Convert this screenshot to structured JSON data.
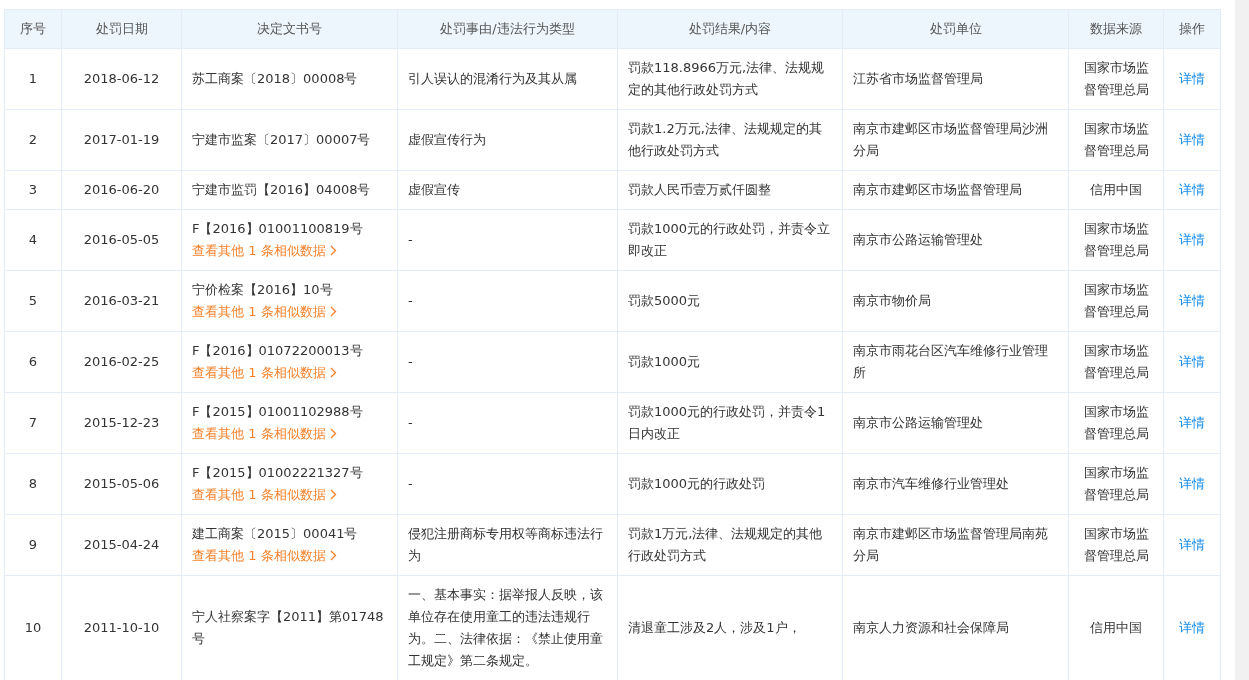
{
  "table": {
    "columns": [
      "序号",
      "处罚日期",
      "决定文书号",
      "处罚事由/违法行为类型",
      "处罚结果/内容",
      "处罚单位",
      "数据来源",
      "操作"
    ],
    "rows": [
      {
        "index": "1",
        "date": "2018-06-12",
        "doc_number": "苏工商案〔2018〕00008号",
        "reason": "引人误认的混淆行为及其从属",
        "result": "罚款118.8966万元,法律、法规规定的其他行政处罚方式",
        "authority": "江苏省市场监督管理局",
        "source": "国家市场监督管理总局",
        "action": "详情"
      },
      {
        "index": "2",
        "date": "2017-01-19",
        "doc_number": "宁建市监案〔2017〕00007号",
        "reason": "虚假宣传行为",
        "result": "罚款1.2万元,法律、法规规定的其他行政处罚方式",
        "authority": "南京市建邺区市场监督管理局沙洲分局",
        "source": "国家市场监督管理总局",
        "action": "详情"
      },
      {
        "index": "3",
        "date": "2016-06-20",
        "doc_number": "宁建市监罚【2016】04008号",
        "reason": "虚假宣传",
        "result": "罚款人民币壹万贰仟圆整",
        "authority": "南京市建邺区市场监督管理局",
        "source": "信用中国",
        "action": "详情"
      },
      {
        "index": "4",
        "date": "2016-05-05",
        "doc_number": "F【2016】01001100819号",
        "similar_link": "查看其他 1 条相似数据",
        "reason": "-",
        "result": "罚款1000元的行政处罚，并责令立即改正",
        "authority": "南京市公路运输管理处",
        "source": "国家市场监督管理总局",
        "action": "详情"
      },
      {
        "index": "5",
        "date": "2016-03-21",
        "doc_number": "宁价检案【2016】10号",
        "similar_link": "查看其他 1 条相似数据",
        "reason": "-",
        "result": "罚款5000元",
        "authority": "南京市物价局",
        "source": "国家市场监督管理总局",
        "action": "详情"
      },
      {
        "index": "6",
        "date": "2016-02-25",
        "doc_number": "F【2016】01072200013号",
        "similar_link": "查看其他 1 条相似数据",
        "reason": "-",
        "result": "罚款1000元",
        "authority": "南京市雨花台区汽车维修行业管理所",
        "source": "国家市场监督管理总局",
        "action": "详情"
      },
      {
        "index": "7",
        "date": "2015-12-23",
        "doc_number": "F【2015】01001102988号",
        "similar_link": "查看其他 1 条相似数据",
        "reason": "-",
        "result": "罚款1000元的行政处罚，并责令1日内改正",
        "authority": "南京市公路运输管理处",
        "source": "国家市场监督管理总局",
        "action": "详情"
      },
      {
        "index": "8",
        "date": "2015-05-06",
        "doc_number": "F【2015】01002221327号",
        "similar_link": "查看其他 1 条相似数据",
        "reason": "-",
        "result": "罚款1000元的行政处罚",
        "authority": "南京市汽车维修行业管理处",
        "source": "国家市场监督管理总局",
        "action": "详情"
      },
      {
        "index": "9",
        "date": "2015-04-24",
        "doc_number": "建工商案〔2015〕00041号",
        "similar_link": "查看其他 1 条相似数据",
        "reason": "侵犯注册商标专用权等商标违法行为",
        "result": "罚款1万元,法律、法规规定的其他行政处罚方式",
        "authority": "南京市建邺区市场监督管理局南苑分局",
        "source": "国家市场监督管理总局",
        "action": "详情"
      },
      {
        "index": "10",
        "date": "2011-10-10",
        "doc_number": "宁人社察案字【2011】第01748号",
        "reason": "一、基本事实：据举报人反映，该单位存在使用童工的违法违规行为。二、法律依据：《禁止使用童工规定》第二条规定。",
        "result": "清退童工涉及2人，涉及1户，",
        "authority": "南京人力资源和社会保障局",
        "source": "信用中国",
        "action": "详情"
      }
    ]
  }
}
